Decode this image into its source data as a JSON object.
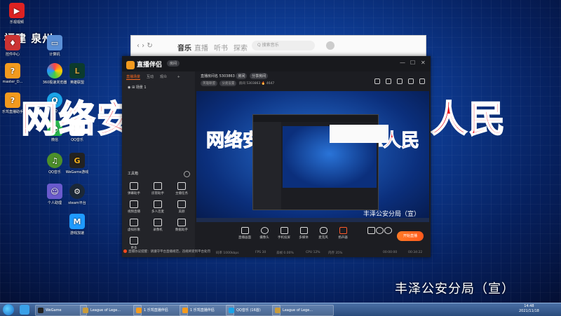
{
  "desktop": {
    "region_logo": "福建",
    "region_logo_2": "泉州",
    "icons": [
      {
        "label": "乐视视频",
        "color": "#d22"
      },
      {
        "label": "控件中心",
        "color": "#c33"
      },
      {
        "label": "计算机",
        "color": "#5a8fd6"
      },
      {
        "label": "master_D...",
        "color": "#f39a1e"
      },
      {
        "label": "360极速浏览器",
        "color": "#4caf50"
      },
      {
        "label": "英雄联盟",
        "color": "#0b3b2e"
      },
      {
        "label": "乐驾直播助手",
        "color": "#f39a1e"
      },
      {
        "label": "QQ",
        "color": "#1aa3e8"
      },
      {
        "label": "微信",
        "color": "#2bb54d"
      },
      {
        "label": "QQ音乐",
        "color": "#f4c20d"
      },
      {
        "label": "WeGame游戏",
        "color": "#222"
      },
      {
        "label": "个人助理",
        "color": "#6a5acd"
      },
      {
        "label": "steam平台",
        "color": "#1b2838"
      },
      {
        "label": "游戏加速",
        "color": "#1f9bff"
      }
    ],
    "banner_left": "网络安",
    "banner_right": "靠人民",
    "caption": "丰泽公安分局（宣）"
  },
  "music_window": {
    "nav": "‹  ›  ↻",
    "tabs": [
      "音乐",
      "直播",
      "听书",
      "探索"
    ],
    "search_placeholder": "Q 搜索音乐"
  },
  "app": {
    "name": "直播伴侣",
    "room_badge": "房间",
    "window_controls": [
      "—",
      "☐",
      "✕"
    ],
    "sidebar_tabs": [
      "直播场景",
      "互动",
      "观众"
    ],
    "scene_name": "场景 1",
    "tools_title": "工具箱",
    "tools": [
      {
        "label": "弹幕助手"
      },
      {
        "label": "房管助手"
      },
      {
        "label": "主播任务"
      },
      {
        "label": "视频直播"
      },
      {
        "label": "多人连麦"
      },
      {
        "label": "美颜"
      },
      {
        "label": "虚拟形象"
      },
      {
        "label": "录像机"
      },
      {
        "label": "数据助手"
      },
      {
        "label": "更多"
      }
    ],
    "notice": "直播协议提醒：请遵守平台直播规范，违规将受到平台处罚",
    "room_title": "直播房间名 5303863",
    "room_id_label": "房间",
    "room_edit": "分享房间",
    "room_meta": [
      "英雄联盟",
      "分类设置",
      "房间",
      "5303863",
      "4647"
    ],
    "preview_banner_left": "网络安",
    "preview_banner_right": "靠人民",
    "preview_caption": "丰泽公安分局（宣）",
    "controls": [
      {
        "label": "直播画面"
      },
      {
        "label": "摄像头"
      },
      {
        "label": "手机投屏"
      },
      {
        "label": "多媒体"
      },
      {
        "label": "麦克风"
      },
      {
        "label": "扬声器"
      }
    ],
    "start_label": "开始直播",
    "status": [
      "码率 1000kbps",
      "FPS 30",
      "丢帧 0.00%",
      "CPU 12%",
      "内存 35%",
      "00:00:00",
      "00:34:22"
    ]
  },
  "taskbar": {
    "items": [
      {
        "label": "WeGame",
        "color": "#222"
      },
      {
        "label": "League of Lege...",
        "color": "#c89b3c"
      },
      {
        "label": "1 乐驾直播伴侣",
        "color": "#f39a1e"
      },
      {
        "label": "1 乐驾直播伴侣",
        "color": "#f39a1e"
      },
      {
        "label": "QQ音乐 (16首)",
        "color": "#1aa3e8"
      },
      {
        "label": "League of Lege...",
        "color": "#c89b3c"
      }
    ],
    "time": "14:48",
    "date": "2021/11/18"
  }
}
